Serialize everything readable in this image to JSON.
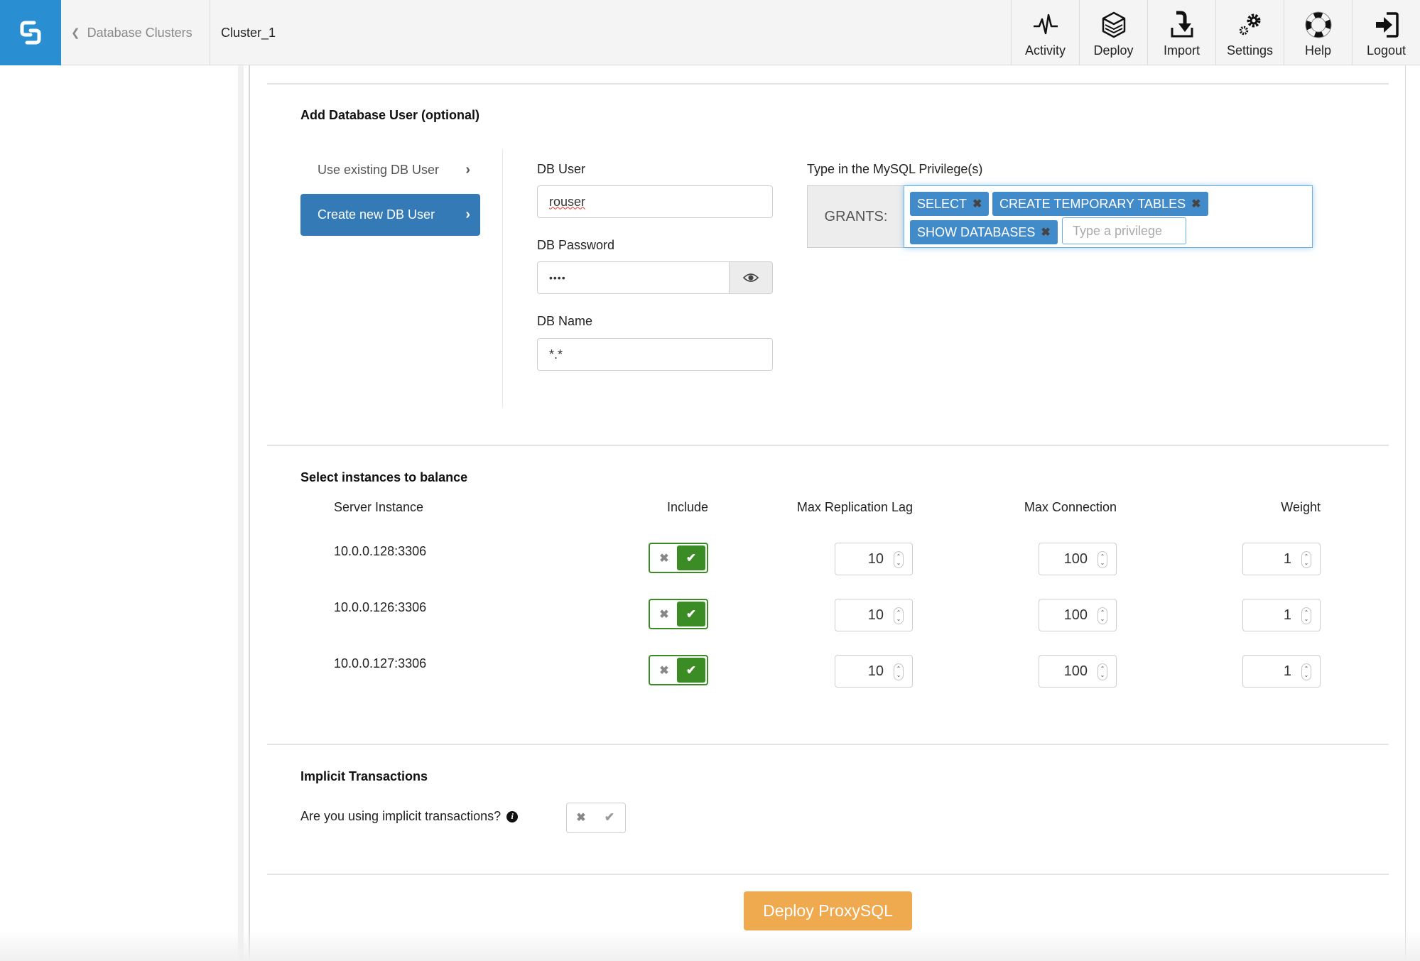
{
  "header": {
    "logo": "severalnines-logo-icon",
    "breadcrumb_back": "Database Clusters",
    "breadcrumb_current": "Cluster_1",
    "nav": [
      {
        "label": "Activity",
        "icon": "activity-pulse-icon"
      },
      {
        "label": "Deploy",
        "icon": "deploy-layers-icon"
      },
      {
        "label": "Import",
        "icon": "import-icon"
      },
      {
        "label": "Settings",
        "icon": "settings-gears-icon"
      },
      {
        "label": "Help",
        "icon": "help-lifebuoy-icon"
      },
      {
        "label": "Logout",
        "icon": "logout-icon"
      }
    ]
  },
  "db_user_section": {
    "title": "Add Database User (optional)",
    "use_existing_label": "Use existing DB User",
    "create_new_label": "Create new DB User",
    "db_user_label": "DB User",
    "db_user_value": "rouser",
    "db_password_label": "DB Password",
    "db_password_value": "••••",
    "db_name_label": "DB Name",
    "db_name_value": "*.*",
    "privileges_label": "Type in the MySQL Privilege(s)",
    "grants_label": "GRANTS:",
    "privileges": [
      "SELECT",
      "CREATE TEMPORARY TABLES",
      "SHOW DATABASES"
    ],
    "privilege_placeholder": "Type a privilege"
  },
  "instances_section": {
    "title": "Select instances to balance",
    "columns": [
      "Server Instance",
      "Include",
      "Max Replication Lag",
      "Max Connection",
      "Weight"
    ],
    "rows": [
      {
        "instance": "10.0.0.128:3306",
        "include": true,
        "max_replication_lag": "10",
        "max_connection": "100",
        "weight": "1"
      },
      {
        "instance": "10.0.0.126:3306",
        "include": true,
        "max_replication_lag": "10",
        "max_connection": "100",
        "weight": "1"
      },
      {
        "instance": "10.0.0.127:3306",
        "include": true,
        "max_replication_lag": "10",
        "max_connection": "100",
        "weight": "1"
      }
    ]
  },
  "implicit_section": {
    "title": "Implicit Transactions",
    "question": "Are you using implicit transactions?",
    "value": null
  },
  "deploy_button_label": "Deploy ProxySQL",
  "colors": {
    "brand_blue": "#2a8fd2",
    "primary_button": "#337ab7",
    "tag_blue": "#428bca",
    "toggle_green": "#3c8c25",
    "deploy_orange": "#efa94f"
  }
}
